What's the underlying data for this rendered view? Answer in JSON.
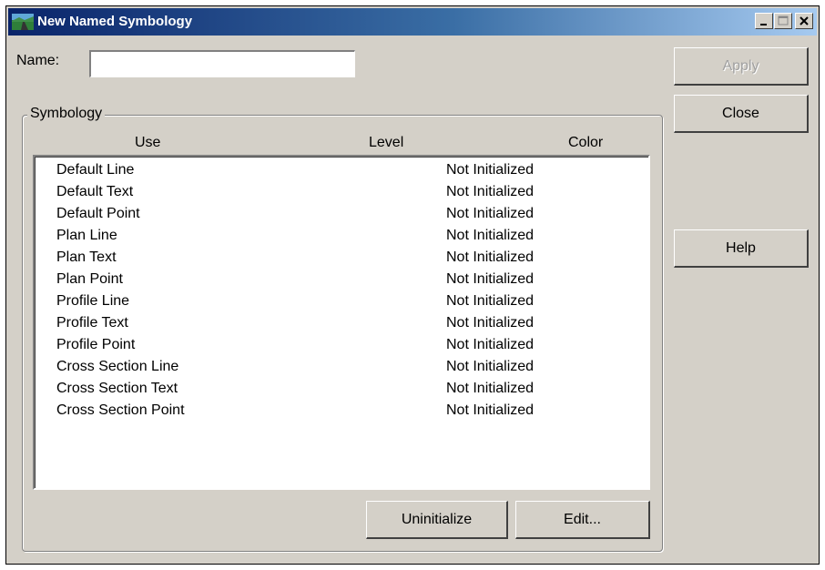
{
  "window": {
    "title": "New Named Symbology"
  },
  "form": {
    "name_label": "Name:",
    "name_value": ""
  },
  "symbology": {
    "group_label": "Symbology",
    "columns": {
      "use": "Use",
      "level": "Level",
      "color": "Color"
    },
    "rows": [
      {
        "use": "Default Line",
        "level": "Not Initialized"
      },
      {
        "use": "Default Text",
        "level": "Not Initialized"
      },
      {
        "use": "Default Point",
        "level": "Not Initialized"
      },
      {
        "use": "Plan Line",
        "level": "Not Initialized"
      },
      {
        "use": "Plan Text",
        "level": "Not Initialized"
      },
      {
        "use": "Plan Point",
        "level": "Not Initialized"
      },
      {
        "use": "Profile Line",
        "level": "Not Initialized"
      },
      {
        "use": "Profile Text",
        "level": "Not Initialized"
      },
      {
        "use": "Profile Point",
        "level": "Not Initialized"
      },
      {
        "use": "Cross Section Line",
        "level": "Not Initialized"
      },
      {
        "use": "Cross Section Text",
        "level": "Not Initialized"
      },
      {
        "use": "Cross Section Point",
        "level": "Not Initialized"
      }
    ]
  },
  "buttons": {
    "apply": "Apply",
    "close": "Close",
    "help": "Help",
    "uninitialize": "Uninitialize",
    "edit": "Edit..."
  },
  "icons": {
    "app": "road-landscape-icon",
    "minimize": "minimize-icon",
    "maximize": "maximize-icon",
    "close": "close-icon"
  },
  "colors": {
    "title_start": "#0a246a",
    "title_end": "#a6caf0",
    "face": "#d4d0c8"
  }
}
